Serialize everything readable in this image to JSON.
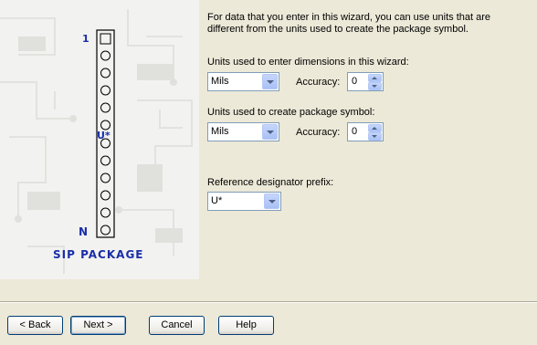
{
  "package": {
    "pin_first_label": "1",
    "pin_last_label": "N",
    "ref_marker": "U*",
    "title": "SIP PACKAGE"
  },
  "intro_text": "For data that you enter in this wizard, you can use units that are different from the units used to create the package symbol.",
  "wizard_units": {
    "label": "Units used to enter dimensions in this wizard:",
    "value": "Mils",
    "accuracy_label": "Accuracy:",
    "accuracy_value": "0"
  },
  "symbol_units": {
    "label": "Units used to create package symbol:",
    "value": "Mils",
    "accuracy_label": "Accuracy:",
    "accuracy_value": "0"
  },
  "refdes": {
    "label": "Reference designator prefix:",
    "value": "U*"
  },
  "buttons": {
    "back": "< Back",
    "next": "Next >",
    "cancel": "Cancel",
    "help": "Help"
  },
  "colors": {
    "accent": "#1a2ea8",
    "dialog_bg": "#ece9d8"
  }
}
